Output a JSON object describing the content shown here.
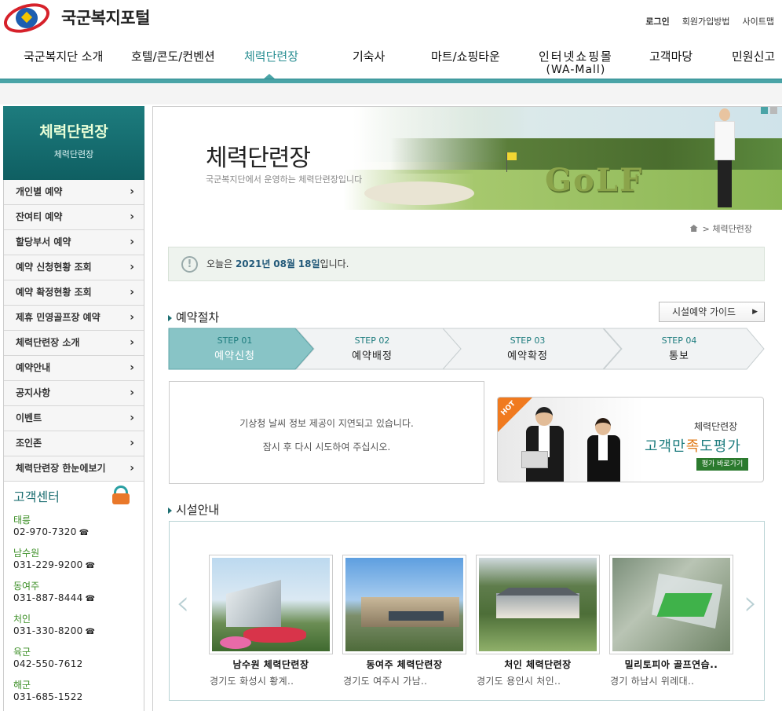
{
  "header": {
    "logo_text": "국군복지포털",
    "links": [
      "로그인",
      "회원가입방법",
      "사이트맵"
    ]
  },
  "gnb": [
    {
      "label": "국군복지단 소개"
    },
    {
      "label": "호텔/콘도/컨벤션"
    },
    {
      "label": "체력단련장",
      "active": true
    },
    {
      "label": "기숙사"
    },
    {
      "label": "마트/쇼핑타운"
    },
    {
      "label": "인터넷쇼핑몰",
      "sub": "(WA-Mall)"
    },
    {
      "label": "고객마당"
    },
    {
      "label": "민원신고"
    }
  ],
  "sidebar": {
    "title": "체력단련장",
    "subtitle": "체력단련장",
    "items": [
      "개인별 예약",
      "잔여티 예약",
      "할당부서 예약",
      "예약 신청현황 조회",
      "예약 확정현황 조회",
      "제휴 민영골프장 예약",
      "체력단련장 소개",
      "예약안내",
      "공지사항",
      "이벤트",
      "조인존",
      "체력단련장 한눈에보기"
    ],
    "customer_center": {
      "title": "고객센터",
      "entries": [
        {
          "name": "태릉",
          "phone": "02-970-7320",
          "tel_icon": true
        },
        {
          "name": "남수원",
          "phone": "031-229-9200",
          "tel_icon": true
        },
        {
          "name": "동여주",
          "phone": "031-887-8444",
          "tel_icon": true
        },
        {
          "name": "처인",
          "phone": "031-330-8200",
          "tel_icon": true
        },
        {
          "name": "육군",
          "phone": "042-550-7612",
          "tel_icon": false
        },
        {
          "name": "해군",
          "phone": "031-685-1522",
          "tel_icon": false
        }
      ]
    }
  },
  "banner": {
    "title": "체력단련장",
    "subtitle": "국군복지단에서 운영하는 체력단련장입니다",
    "golf_text": "GoLF"
  },
  "breadcrumb": "체력단련장",
  "today": {
    "prefix": "오늘은 ",
    "year": "2021년",
    "month": "08월",
    "day": "18일",
    "suffix": "입니다."
  },
  "reservation": {
    "title": "예약절차",
    "guide_button": "시설예약 가이드",
    "steps": [
      {
        "num": "STEP 01",
        "label": "예약신청",
        "active": true
      },
      {
        "num": "STEP 02",
        "label": "예약배정"
      },
      {
        "num": "STEP 03",
        "label": "예약확정"
      },
      {
        "num": "STEP 04",
        "label": "통보"
      }
    ]
  },
  "weather": {
    "line1": "기상청 날씨 정보 제공이 지연되고 있습니다.",
    "line2": "잠시 후 다시 시도하여 주십시오."
  },
  "promo": {
    "hot": "HOT",
    "line1": "체력단련장",
    "line2a": "고객만",
    "line2b": "족",
    "line2c": "도평가",
    "button": "평가 바로가기"
  },
  "facilities": {
    "title": "시설안내",
    "items": [
      {
        "name": "남수원 체력단련장",
        "addr": "경기도 화성시 황계.."
      },
      {
        "name": "동여주 체력단련장",
        "addr": "경기도 여주시 가남.."
      },
      {
        "name": "처인 체력단련장",
        "addr": "경기도 용인시 처인.."
      },
      {
        "name": "밀리토피아 골프연습..",
        "addr": "경기 하남시 위례대.."
      }
    ]
  },
  "colors": {
    "accent": "#4aa4a7",
    "sidebar_header": "#1d7c7e",
    "step_active": "#88c4c6"
  }
}
